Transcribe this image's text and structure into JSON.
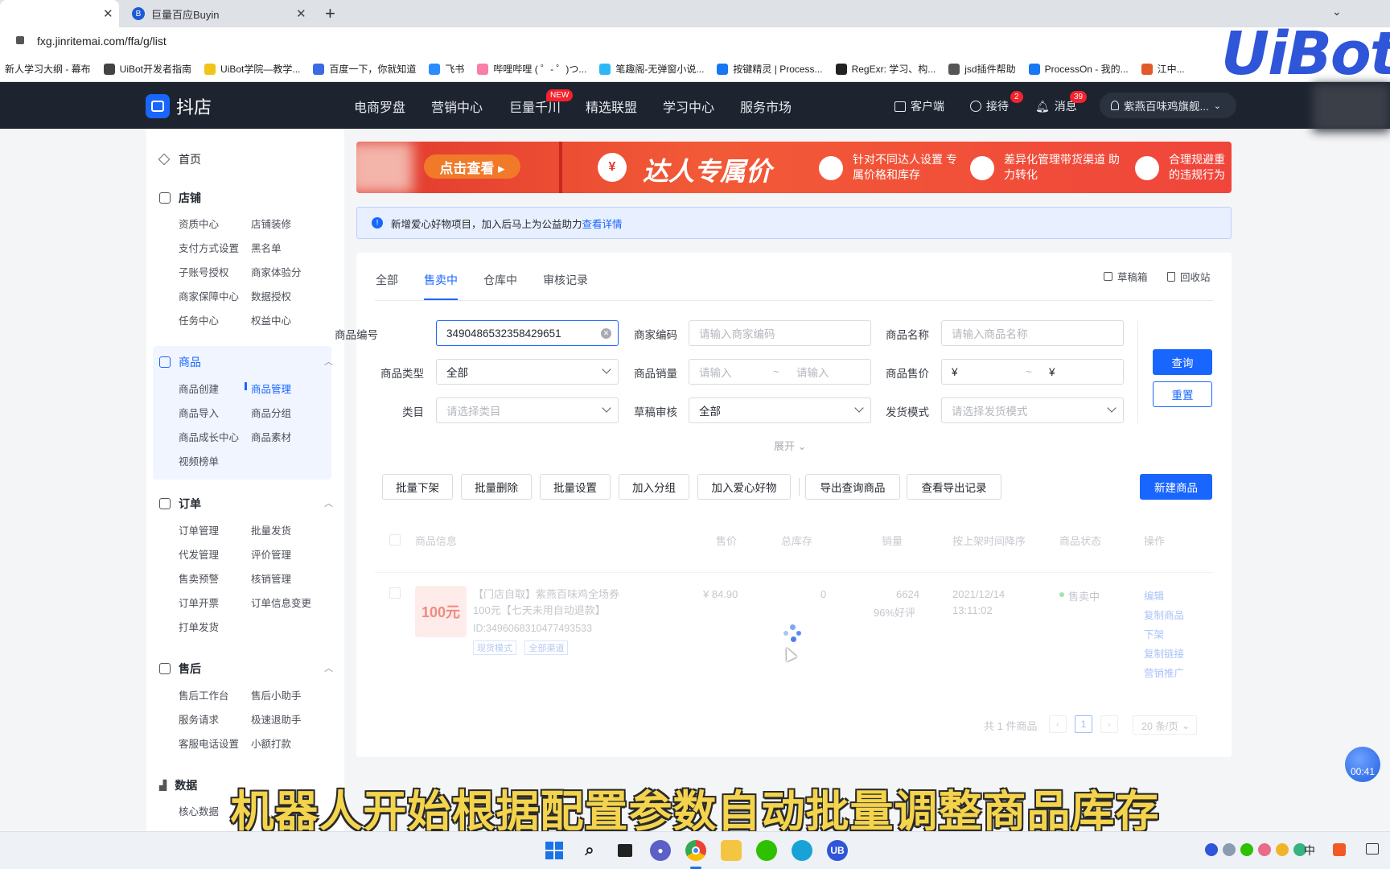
{
  "browser": {
    "tabs": [
      {
        "label": "",
        "active": true
      },
      {
        "label": "巨量百应Buyin",
        "active": false
      }
    ],
    "url": "fxg.jinritemai.com/ffa/g/list",
    "bookmarks": [
      "新人学习大纲 - 幕布",
      "UiBot开发者指南",
      "UiBot学院—教学...",
      "百度一下，你就知道",
      "飞书",
      "哔哩哔哩 ( ゜- ゜)つ...",
      "笔趣阁-无弹窗小说...",
      "按键精灵 | Process...",
      "RegExr: 学习、构...",
      "jsd插件帮助",
      "ProcessOn - 我的...",
      "江中..."
    ],
    "watermark": "UiBot"
  },
  "header": {
    "logo": "抖店",
    "nav": [
      "电商罗盘",
      "营销中心",
      "巨量千川",
      "精选联盟",
      "学习中心",
      "服务市场"
    ],
    "new_badge": "NEW",
    "client": "客户端",
    "reception": "接待",
    "reception_count": "2",
    "messages": "消息",
    "messages_count": "39",
    "account": "紫燕百味鸡旗舰..."
  },
  "sidebar": {
    "home": "首页",
    "shop": {
      "title": "店铺",
      "items": [
        "资质中心",
        "店铺装修",
        "支付方式设置",
        "黑名单",
        "子账号授权",
        "商家体验分",
        "商家保障中心",
        "数据授权",
        "任务中心",
        "权益中心"
      ]
    },
    "goods": {
      "title": "商品",
      "items": [
        "商品创建",
        "商品管理",
        "商品导入",
        "商品分组",
        "商品成长中心",
        "商品素材",
        "视频榜单"
      ]
    },
    "orders": {
      "title": "订单",
      "items": [
        "订单管理",
        "批量发货",
        "代发管理",
        "评价管理",
        "售卖预警",
        "核销管理",
        "订单开票",
        "订单信息变更",
        "打单发货"
      ]
    },
    "aftersale": {
      "title": "售后",
      "items": [
        "售后工作台",
        "售后小助手",
        "服务请求",
        "极速退助手",
        "客服电话设置",
        "小额打款"
      ]
    },
    "data": {
      "title": "数据",
      "items": [
        "核心数据"
      ]
    }
  },
  "banner": {
    "cta": "点击查看 ▸",
    "headline": "达人专属价",
    "point1": "针对不同达人设置 专属价格和库存",
    "point2": "差异化管理带货渠道 助力转化",
    "point3": "合理规避重 的违规行为"
  },
  "notice": {
    "text": "新增爱心好物项目，加入后马上为公益助力",
    "link": "查看详情"
  },
  "tabs": {
    "items": [
      "全部",
      "售卖中",
      "仓库中",
      "审核记录"
    ],
    "active": "售卖中",
    "drafts": "草稿箱",
    "recycle": "回收站"
  },
  "filters": {
    "product_id_label": "商品编号",
    "product_id_value": "3490486532358429651",
    "merchant_code_label": "商家编码",
    "merchant_code_ph": "请输入商家编码",
    "name_label": "商品名称",
    "name_ph": "请输入商品名称",
    "type_label": "商品类型",
    "type_value": "全部",
    "sales_label": "商品销量",
    "sales_from_ph": "请输入",
    "sales_to_ph": "请输入",
    "range_sep": "~",
    "price_label": "商品售价",
    "price_symbol": "¥",
    "category_label": "类目",
    "category_ph": "请选择类目",
    "draft_review_label": "草稿审核",
    "draft_review_value": "全部",
    "ship_mode_label": "发货模式",
    "ship_mode_ph": "请选择发货模式",
    "expand": "展开",
    "query": "查询",
    "reset": "重置"
  },
  "actions": [
    "批量下架",
    "批量删除",
    "批量设置",
    "加入分组",
    "加入爱心好物",
    "导出查询商品",
    "查看导出记录"
  ],
  "new_product": "新建商品",
  "table": {
    "headers": [
      "商品信息",
      "售价",
      "总库存",
      "销量",
      "按上架时间降序",
      "商品状态",
      "操作"
    ],
    "row": {
      "title": "【门店自取】紫燕百味鸡全场券100元【七天未用自动退款】",
      "id": "ID:3496068310477493533",
      "tags": [
        "现货模式",
        "全部渠道"
      ],
      "thumb_text": "100元",
      "price": "¥ 84.90",
      "stock": "0",
      "sales": "6624",
      "rating": "96%好评",
      "date": "2021/12/14",
      "time": "13:11:02",
      "status": "售卖中",
      "ops": [
        "编辑",
        "复制商品",
        "下架",
        "复制链接",
        "营销推广"
      ]
    }
  },
  "pagination": {
    "total": "共 1 件商品",
    "page": "1",
    "per_page": "20 条/页"
  },
  "timer": "00:41",
  "subtitle": "机器人开始根据配置参数自动批量调整商品库存",
  "taskbar": {
    "ime": "中"
  }
}
